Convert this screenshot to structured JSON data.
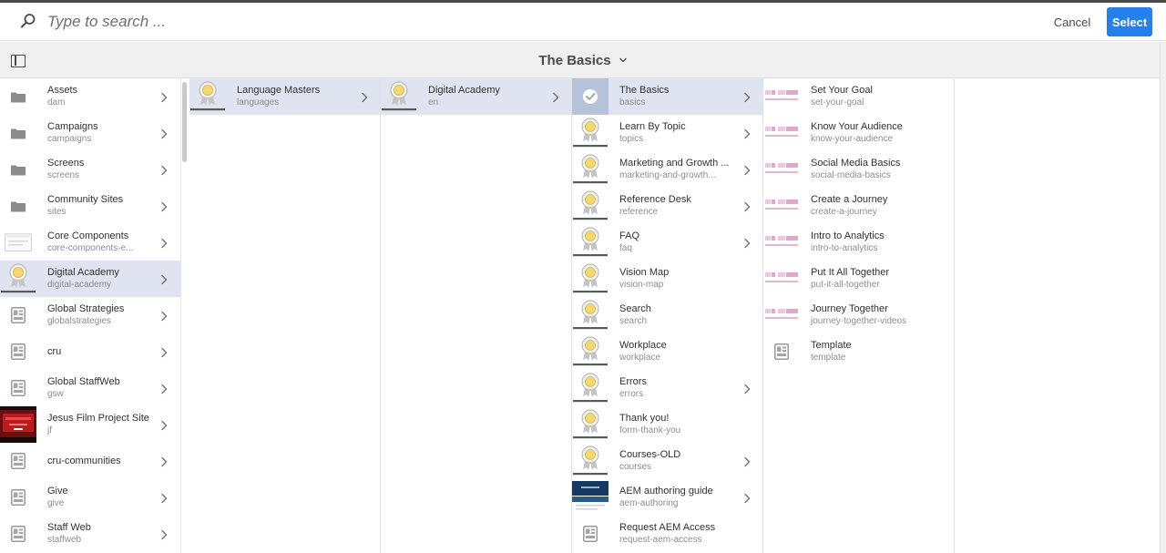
{
  "search": {
    "placeholder": "Type to search ..."
  },
  "actions": {
    "cancel_label": "Cancel",
    "select_label": "Select"
  },
  "header": {
    "title": "The Basics"
  },
  "colors": {
    "accent": "#2680eb",
    "selected_row": "#dfe4f0",
    "header_bg": "#f0f0f0"
  },
  "columns": [
    {
      "items": [
        {
          "title": "Assets",
          "subtitle": "dam",
          "icon": "folder-icon",
          "chevron": true
        },
        {
          "title": "Campaigns",
          "subtitle": "campaigns",
          "icon": "folder-icon",
          "chevron": true
        },
        {
          "title": "Screens",
          "subtitle": "screens",
          "icon": "folder-icon",
          "chevron": true
        },
        {
          "title": "Community Sites",
          "subtitle": "sites",
          "icon": "folder-icon",
          "chevron": true
        },
        {
          "title": "Core Components",
          "subtitle": "core-components-e...",
          "icon": "component-thumb",
          "chevron": true
        },
        {
          "title": "Digital Academy",
          "subtitle": "digital-academy",
          "icon": "digital-academy-badge",
          "chevron": true,
          "active": true
        },
        {
          "title": "Global Strategies",
          "subtitle": "globalstrategies",
          "icon": "page-icon",
          "chevron": true
        },
        {
          "title": "cru",
          "subtitle": "",
          "icon": "page-icon",
          "chevron": true
        },
        {
          "title": "Global StaffWeb",
          "subtitle": "gsw",
          "icon": "page-icon",
          "chevron": true
        },
        {
          "title": "Jesus Film Project Site",
          "subtitle": "jf",
          "icon": "film-thumb",
          "chevron": true
        },
        {
          "title": "cru-communities",
          "subtitle": "",
          "icon": "page-icon",
          "chevron": true
        },
        {
          "title": "Give",
          "subtitle": "give",
          "icon": "page-icon",
          "chevron": true
        },
        {
          "title": "Staff Web",
          "subtitle": "staffweb",
          "icon": "page-icon",
          "chevron": true
        }
      ]
    },
    {
      "items": [
        {
          "title": "Language Masters",
          "subtitle": "languages",
          "icon": "digital-academy-badge",
          "chevron": true,
          "active": true
        }
      ]
    },
    {
      "items": [
        {
          "title": "Digital Academy",
          "subtitle": "en",
          "icon": "digital-academy-badge",
          "chevron": true,
          "active": true
        }
      ]
    },
    {
      "items": [
        {
          "title": "The Basics",
          "subtitle": "basics",
          "icon": "checked-thumb",
          "chevron": true,
          "active": true
        },
        {
          "title": "Learn By Topic",
          "subtitle": "topics",
          "icon": "digital-academy-badge",
          "chevron": true
        },
        {
          "title": "Marketing and Growth ...",
          "subtitle": "marketing-and-growth...",
          "icon": "digital-academy-badge",
          "chevron": true
        },
        {
          "title": "Reference Desk",
          "subtitle": "reference",
          "icon": "digital-academy-badge",
          "chevron": true
        },
        {
          "title": "FAQ",
          "subtitle": "faq",
          "icon": "digital-academy-badge",
          "chevron": true
        },
        {
          "title": "Vision Map",
          "subtitle": "vision-map",
          "icon": "digital-academy-badge",
          "chevron": false
        },
        {
          "title": "Search",
          "subtitle": "search",
          "icon": "digital-academy-badge",
          "chevron": false
        },
        {
          "title": "Workplace",
          "subtitle": "workplace",
          "icon": "digital-academy-badge",
          "chevron": false
        },
        {
          "title": "Errors",
          "subtitle": "errors",
          "icon": "digital-academy-badge",
          "chevron": true
        },
        {
          "title": "Thank you!",
          "subtitle": "form-thank-you",
          "icon": "digital-academy-badge",
          "chevron": false
        },
        {
          "title": "Courses-OLD",
          "subtitle": "courses",
          "icon": "digital-academy-badge",
          "chevron": true
        },
        {
          "title": "AEM authoring guide",
          "subtitle": "aem-authoring",
          "icon": "aem-guide-thumb",
          "chevron": true
        },
        {
          "title": "Request AEM Access",
          "subtitle": "request-aem-access",
          "icon": "page-icon",
          "chevron": false
        }
      ]
    },
    {
      "items": [
        {
          "title": "Set Your Goal",
          "subtitle": "set-your-goal",
          "icon": "pink-thumb",
          "chevron": false
        },
        {
          "title": "Know Your Audience",
          "subtitle": "know-your-audience",
          "icon": "pink-thumb",
          "chevron": false
        },
        {
          "title": "Social Media Basics",
          "subtitle": "social-media-basics",
          "icon": "pink-thumb",
          "chevron": false
        },
        {
          "title": "Create a Journey",
          "subtitle": "create-a-journey",
          "icon": "pink-thumb",
          "chevron": false
        },
        {
          "title": "Intro to Analytics",
          "subtitle": "intro-to-analytics",
          "icon": "pink-thumb",
          "chevron": false
        },
        {
          "title": "Put It All Together",
          "subtitle": "put-it-all-together",
          "icon": "pink-thumb",
          "chevron": false
        },
        {
          "title": "Journey Together",
          "subtitle": "journey-together-videos",
          "icon": "pink-thumb",
          "chevron": false
        },
        {
          "title": "Template",
          "subtitle": "template",
          "icon": "page-icon",
          "chevron": false
        }
      ]
    }
  ]
}
